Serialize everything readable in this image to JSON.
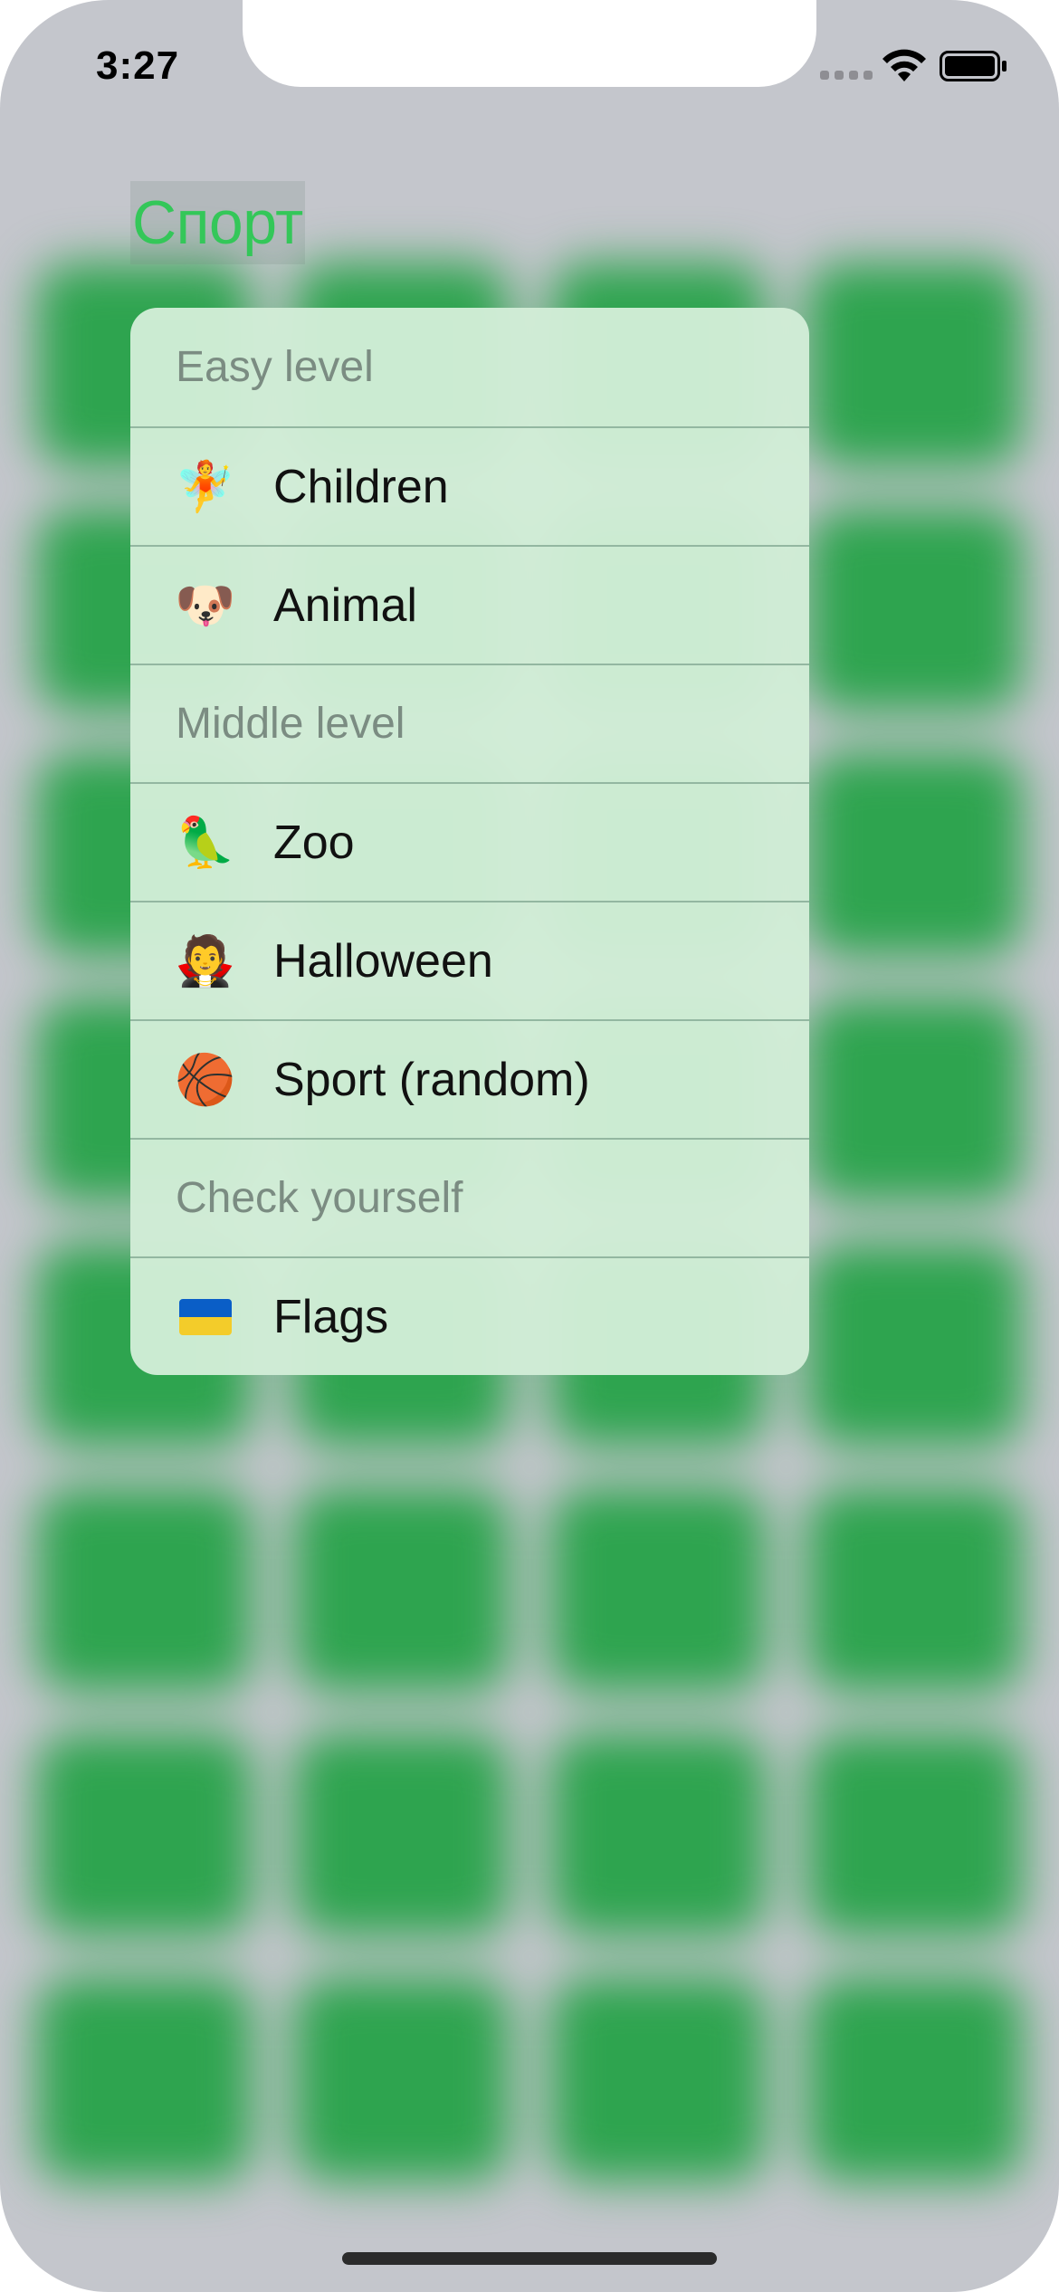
{
  "status_bar": {
    "time": "3:27",
    "signal_icon": "cellular-signal-icon",
    "wifi_icon": "wifi-icon",
    "battery_icon": "battery-full-icon"
  },
  "header": {
    "title": "Спорт"
  },
  "menu": {
    "sections": [
      {
        "title": "Easy level",
        "items": [
          {
            "icon": "🧚",
            "icon_name": "fairy-icon",
            "label": "Children"
          },
          {
            "icon": "🐶",
            "icon_name": "dog-icon",
            "label": "Animal"
          }
        ]
      },
      {
        "title": "Middle level",
        "items": [
          {
            "icon": "🦜",
            "icon_name": "parrot-icon",
            "label": "Zoo"
          },
          {
            "icon": "🧛",
            "icon_name": "vampire-icon",
            "label": "Halloween"
          },
          {
            "icon": "🏀",
            "icon_name": "basketball-icon",
            "label": "Sport (random)"
          }
        ]
      },
      {
        "title": "Check yourself",
        "items": [
          {
            "icon": "",
            "icon_name": "ukraine-flag-icon",
            "label": "Flags"
          }
        ]
      }
    ]
  },
  "colors": {
    "title_green": "#34c759",
    "tile_green": "#2ea44f",
    "menu_background": "#d2edd7",
    "section_text": "#7b8c82"
  }
}
